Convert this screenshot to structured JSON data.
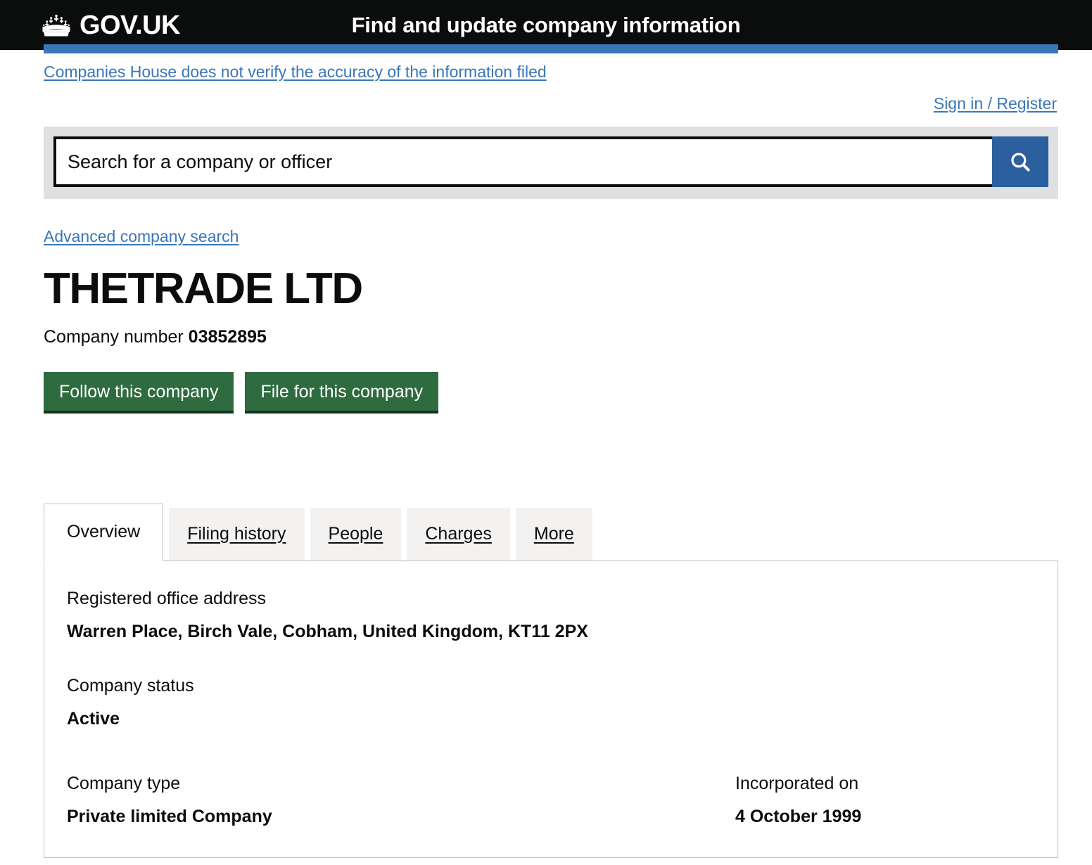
{
  "header": {
    "logo_text": "GOV.UK",
    "crown_icon": "crown-icon",
    "service_name": "Find and update company information"
  },
  "notice": {
    "text": "Companies House does not verify the accuracy of the information filed"
  },
  "account": {
    "sign_in_label": "Sign in / Register"
  },
  "search": {
    "placeholder": "Search for a company or officer",
    "value": "",
    "icon": "search-icon",
    "button_label": "Search",
    "button_color": "#2b5f9e"
  },
  "advanced_search": {
    "label": "Advanced company search"
  },
  "company": {
    "name": "THETRADE LTD",
    "number_label": "Company number",
    "number": "03852895"
  },
  "actions": {
    "follow_label": "Follow this company",
    "file_label": "File for this company",
    "button_color": "#2e6b3e"
  },
  "tabs": [
    {
      "label": "Overview",
      "active": true
    },
    {
      "label": "Filing history",
      "active": false
    },
    {
      "label": "People",
      "active": false
    },
    {
      "label": "Charges",
      "active": false
    },
    {
      "label": "More",
      "active": false
    }
  ],
  "overview": {
    "address_label": "Registered office address",
    "address_value": "Warren Place, Birch Vale, Cobham, United Kingdom, KT11 2PX",
    "status_label": "Company status",
    "status_value": "Active",
    "type_label": "Company type",
    "type_value": "Private limited Company",
    "incorporated_label": "Incorporated on",
    "incorporated_value": "4 October 1999"
  },
  "colors": {
    "brand_black": "#0b0c0c",
    "link_blue": "#3a77b8",
    "accent_blue": "#3a77b8",
    "search_blue": "#2b5f9e",
    "green": "#2e6b3e",
    "grey_panel": "#dee0e2",
    "tab_grey": "#f3f2f1"
  }
}
